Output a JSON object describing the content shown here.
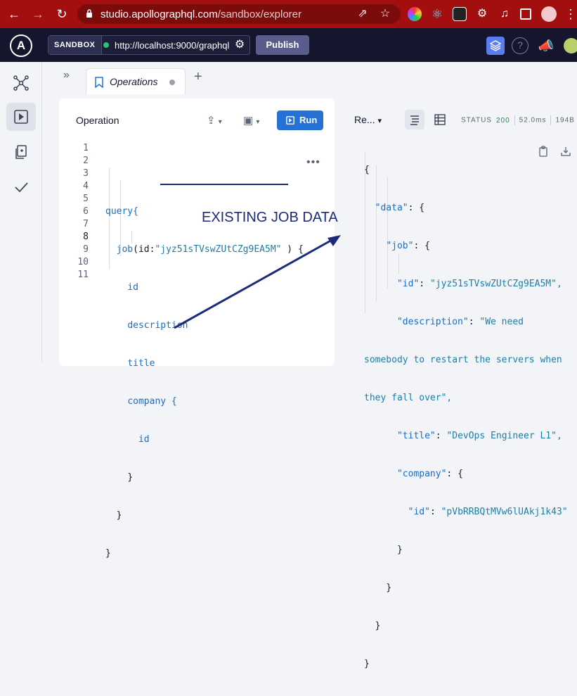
{
  "browser": {
    "url_host": "studio.apollographql.com",
    "url_path": "/sandbox/explorer"
  },
  "topbar": {
    "sandbox_label": "SANDBOX",
    "endpoint_url": "http://localhost:9000/graphql",
    "publish_label": "Publish"
  },
  "tabs": [
    {
      "label": "Operations"
    }
  ],
  "operation": {
    "title": "Operation",
    "run_label": "Run",
    "lines": [
      {
        "n": "1",
        "text": ""
      },
      {
        "n": "2",
        "text": "query{"
      },
      {
        "n": "3",
        "field": "job",
        "open": "(id:",
        "arg": "\"jyz51sTVswZUtCZg9EA5M\"",
        "close": " ) {"
      },
      {
        "n": "4",
        "text": "id"
      },
      {
        "n": "5",
        "text": "description"
      },
      {
        "n": "6",
        "text": "title"
      },
      {
        "n": "7",
        "text": "company {"
      },
      {
        "n": "8",
        "text": "id"
      },
      {
        "n": "9",
        "text": "}"
      },
      {
        "n": "10",
        "text": "}"
      },
      {
        "n": "11",
        "text": "}"
      }
    ]
  },
  "response": {
    "title": "Re...",
    "status_label": "STATUS",
    "status_code": "200",
    "time": "52.0ms",
    "size": "194B",
    "json": {
      "open": "{",
      "data_key": "\"data\"",
      "job_key": "\"job\"",
      "id_key": "\"id\"",
      "id_val": "\"jyz51sTVswZUtCZg9EA5M\",",
      "desc_key": "\"description\"",
      "desc_val_1": "\"We need",
      "desc_val_2": "somebody to restart the servers when",
      "desc_val_3": "they fall over\",",
      "title_key": "\"title\"",
      "title_val": "\"DevOps Engineer L1\",",
      "company_key": "\"company\"",
      "company_id_key": "\"id\"",
      "company_id_val": "\"pVbRRBQtMVw6lUAkj1k43\"",
      "colon": ": ",
      "brace_open": "{",
      "brace_close": "}"
    }
  },
  "annotation": "EXISTING JOB DATA",
  "colors": {
    "chrome": "#a30f0f",
    "topbar": "#15162d",
    "run": "#2572d4",
    "annotation": "#1c2a7a"
  }
}
